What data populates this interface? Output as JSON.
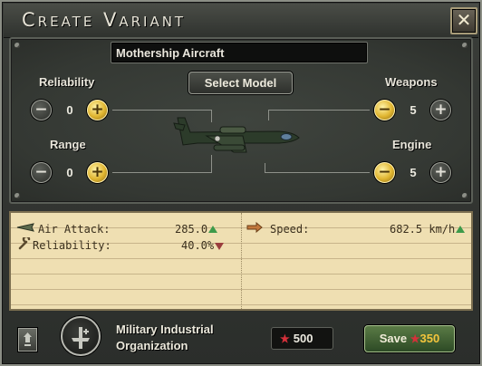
{
  "window": {
    "title": "Create Variant",
    "close_glyph": "✕"
  },
  "design": {
    "variant_name": "Mothership Aircraft",
    "select_model_label": "Select Model",
    "modules": {
      "reliability": {
        "label": "Reliability",
        "value": "0",
        "minus": "−",
        "plus": "+"
      },
      "range": {
        "label": "Range",
        "value": "0",
        "minus": "−",
        "plus": "+"
      },
      "weapons": {
        "label": "Weapons",
        "value": "5",
        "minus": "−",
        "plus": "+"
      },
      "engine": {
        "label": "Engine",
        "value": "5",
        "minus": "−",
        "plus": "+"
      }
    },
    "model_icon": "twin-engine-aircraft-icon"
  },
  "stats": {
    "air_attack": {
      "label": "Air Attack:",
      "value": "285.0",
      "trend": "up",
      "icon": "air-attack-icon"
    },
    "reliability": {
      "label": "Reliability:",
      "value": "40.0%",
      "trend": "down",
      "icon": "wrench-icon"
    },
    "speed": {
      "label": "Speed:",
      "value": "682.5 km/h",
      "trend": "up",
      "icon": "speed-arrow-icon"
    }
  },
  "footer": {
    "mio_line1": "Military Industrial",
    "mio_line2": "Organization",
    "cost": "500",
    "save_label": "Save",
    "save_cost": "350"
  },
  "colors": {
    "trend_up": "#3d9a4a",
    "trend_down": "#9a3d3d",
    "cost_star": "#d6303a",
    "save_cost": "#f4c53c"
  }
}
